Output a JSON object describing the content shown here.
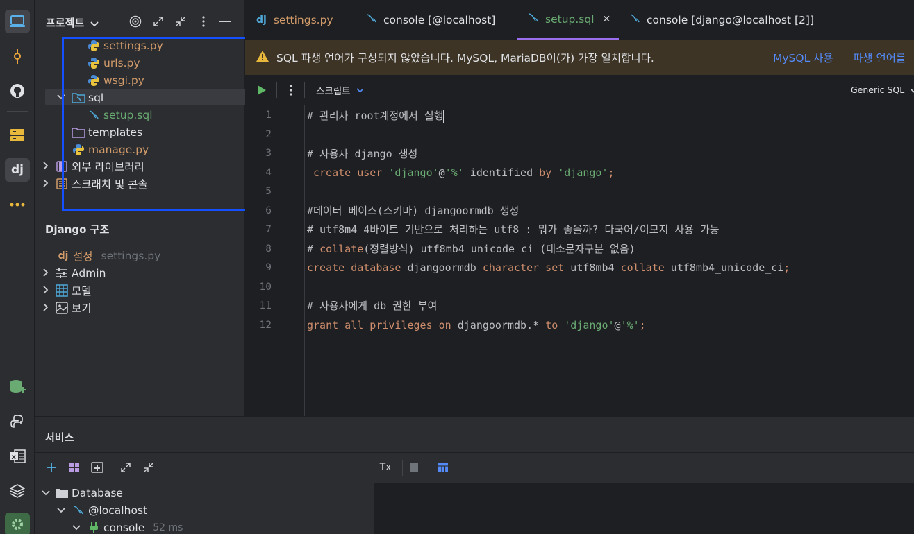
{
  "project_panel": {
    "title": "프로젝트",
    "tree": [
      {
        "label": "settings.py",
        "color": "#d29b6a"
      },
      {
        "label": "urls.py",
        "color": "#d29b6a"
      },
      {
        "label": "wsgi.py",
        "color": "#d29b6a"
      },
      {
        "label": "sql",
        "color": "#dfe1e5"
      },
      {
        "label": "setup.sql",
        "color": "#6aab73"
      },
      {
        "label": "templates",
        "color": "#dfe1e5"
      },
      {
        "label": "manage.py",
        "color": "#d29b6a"
      },
      {
        "label": "외부 라이브러리",
        "color": "#dfe1e5"
      },
      {
        "label": "스크래치 및 콘솔",
        "color": "#dfe1e5"
      }
    ]
  },
  "structure_panel": {
    "title": "Django 구조",
    "items": [
      {
        "label": "설정",
        "extra": "settings.py"
      },
      {
        "label": "Admin"
      },
      {
        "label": "모델"
      },
      {
        "label": "보기"
      }
    ]
  },
  "tabs": [
    {
      "label": "settings.py",
      "active": false
    },
    {
      "label": "console [@localhost]",
      "active": false
    },
    {
      "label": "setup.sql",
      "active": true
    },
    {
      "label": "console [django@localhost [2]]",
      "active": false
    }
  ],
  "banner": {
    "message": "SQL 파생 언어가 구성되지 않았습니다. MySQL, MariaDB이(가) 가장  일치합니다.",
    "action1": "MySQL 사용",
    "action2": "파생 언어를"
  },
  "toolbar": {
    "script_label": "스크립트",
    "dialect": "Generic SQL"
  },
  "editor": {
    "line_numbers": [
      "1",
      "2",
      "3",
      "4",
      "5",
      "6",
      "7",
      "8",
      "9",
      "10",
      "11",
      "12"
    ],
    "lines": {
      "l1": "# 관리자 root계정에서 실행",
      "l3": "# 사용자 django 생성",
      "l4_a": " create user ",
      "l4_b": "'django'",
      "l4_c": "@",
      "l4_d": "'%'",
      "l4_e": " identified ",
      "l4_f": "by",
      "l4_g": " ",
      "l4_h": "'django'",
      "l4_i": ";",
      "l6": "#데이터 베이스(스키마) djangoormdb 생성",
      "l7": "# utf8m4 4바이트 기반으로 처리하는 utf8 : 뭐가 좋을까? 다국어/이모지 사용 가능",
      "l8_a": "# ",
      "l8_b": "collate",
      "l8_c": "(정렬방식) utf8mb4_unicode_ci (대소문자구분 없음)",
      "l9_a": "create database",
      "l9_b": " djangoormdb ",
      "l9_c": "character set",
      "l9_d": " utf8mb4 ",
      "l9_e": "collate",
      "l9_f": " utf8mb4_unicode_ci",
      "l9_g": ";",
      "l11": "# 사용자에게 db 권한 부여",
      "l12_a": "grant all privileges on",
      "l12_b": " djangoormdb.* ",
      "l12_c": "to",
      "l12_d": " ",
      "l12_e": "'django'",
      "l12_f": "@",
      "l12_g": "'%'",
      "l12_h": ";"
    }
  },
  "services": {
    "title": "서비스",
    "tree": [
      {
        "label": "Database"
      },
      {
        "label": "@localhost"
      },
      {
        "label": "console",
        "extra": "52 ms"
      }
    ],
    "tx_label": "Tx"
  }
}
